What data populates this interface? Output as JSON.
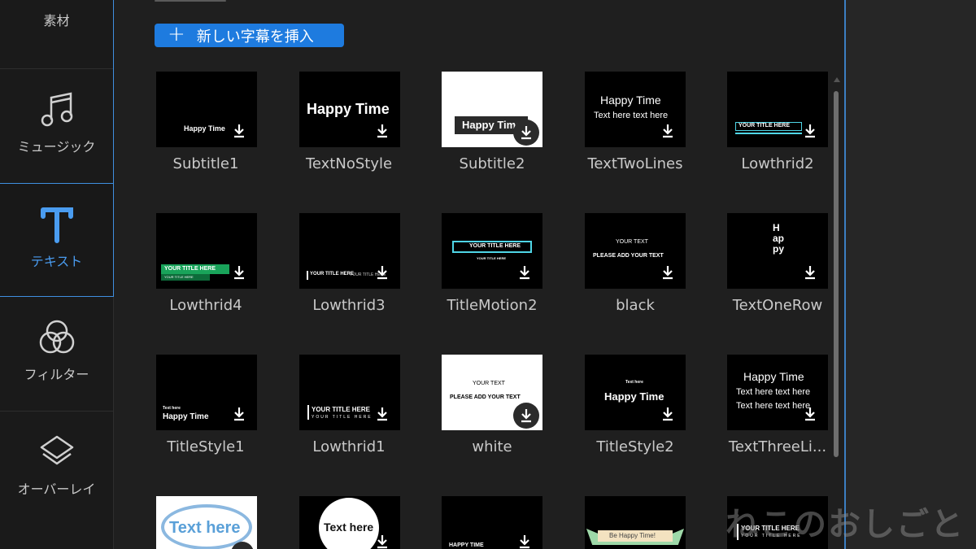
{
  "sidebar": {
    "items": [
      {
        "label": "素材",
        "icon": "media-icon"
      },
      {
        "label": "ミュージック",
        "icon": "music-note-icon"
      },
      {
        "label": "テキスト",
        "icon": "text-t-icon",
        "active": true
      },
      {
        "label": "フィルター",
        "icon": "filter-circles-icon"
      },
      {
        "label": "オーバーレイ",
        "icon": "overlay-layers-icon"
      }
    ]
  },
  "toolbar": {
    "add_subtitle_label": "新しい字幕を挿入",
    "plus": "+"
  },
  "templates": [
    {
      "name": "Subtitle1",
      "preview": [
        "Happy Time"
      ]
    },
    {
      "name": "TextNoStyle",
      "preview": [
        "Happy Time"
      ]
    },
    {
      "name": "Subtitle2",
      "preview": [
        "Happy Time"
      ]
    },
    {
      "name": "TextTwoLines",
      "preview": [
        "Happy Time",
        "Text here text here"
      ]
    },
    {
      "name": "Lowthrid2",
      "preview": [
        "YOUR TITLE HERE"
      ]
    },
    {
      "name": "Lowthrid4",
      "preview": [
        "YOUR TITLE HERE",
        "YOUR TITLE HERE"
      ]
    },
    {
      "name": "Lowthrid3",
      "preview": [
        "YOUR TITLE HERE",
        "YOUR TITLE HERE"
      ]
    },
    {
      "name": "TitleMotion2",
      "preview": [
        "YOUR TITLE HERE",
        "YOUR TITLE HERE"
      ]
    },
    {
      "name": "black",
      "preview": [
        "YOUR TEXT",
        "PLEASE ADD YOUR TEXT"
      ]
    },
    {
      "name": "TextOneRow",
      "preview": [
        "Happy"
      ]
    },
    {
      "name": "TitleStyle1",
      "preview": [
        "Text here",
        "Happy Time"
      ]
    },
    {
      "name": "Lowthrid1",
      "preview": [
        "YOUR TITLE HERE",
        "YOUR TITLE HERE"
      ]
    },
    {
      "name": "white",
      "preview": [
        "YOUR TEXT",
        "PLEASE ADD YOUR TEXT"
      ]
    },
    {
      "name": "TitleStyle2",
      "preview": [
        "Text here",
        "Happy Time"
      ]
    },
    {
      "name": "TextThreeLi...",
      "preview": [
        "Happy Time",
        "Text here text here",
        "Text here text here"
      ]
    },
    {
      "name": "",
      "preview": [
        "Text here"
      ]
    },
    {
      "name": "",
      "preview": [
        "Text here"
      ]
    },
    {
      "name": "",
      "preview": [
        "HAPPY TIME"
      ]
    },
    {
      "name": "",
      "preview": [
        "Be Happy Time!"
      ]
    },
    {
      "name": "",
      "preview": [
        "YOUR TITLE HERE",
        "YOUR TITLE HERE"
      ]
    }
  ],
  "watermark": "ねこのおしごと",
  "colors": {
    "accent": "#1e7bdf",
    "active": "#4a9cf0",
    "green_bar": "#19a35a",
    "cyan": "#4fd5e6"
  }
}
